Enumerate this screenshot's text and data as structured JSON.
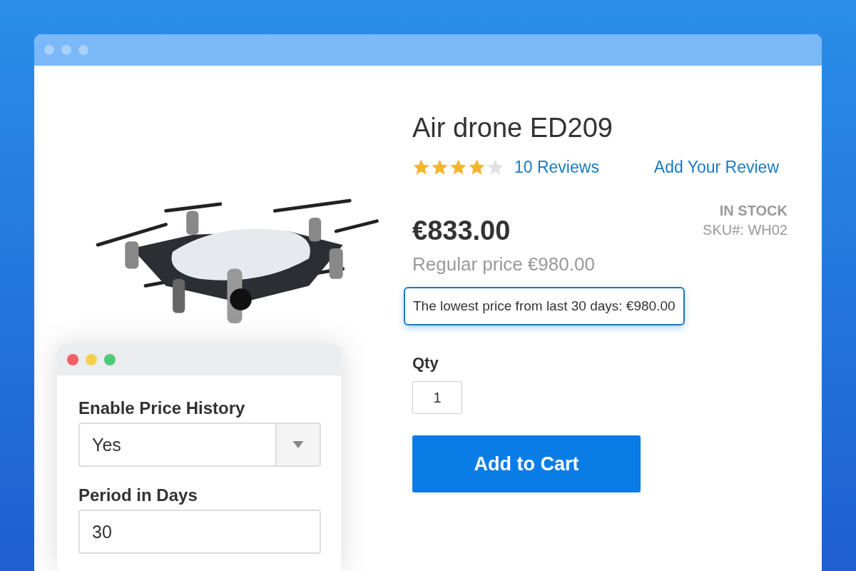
{
  "product": {
    "title": "Air drone ED209",
    "stars": 4,
    "reviews_link": "10 Reviews",
    "add_review_link": "Add Your Review",
    "price": "€833.00",
    "stock": "IN STOCK",
    "sku": "SKU#: WH02",
    "regular_price": "Regular price €980.00",
    "lowest_price": "The lowest price from last 30 days: €980.00",
    "qty_label": "Qty",
    "qty_value": "1",
    "add_to_cart": "Add to Cart"
  },
  "settings": {
    "fields": [
      {
        "kind": "select",
        "label": "Enable Price History",
        "value": "Yes"
      },
      {
        "kind": "input",
        "label": "Period in Days",
        "value": "30"
      }
    ]
  }
}
